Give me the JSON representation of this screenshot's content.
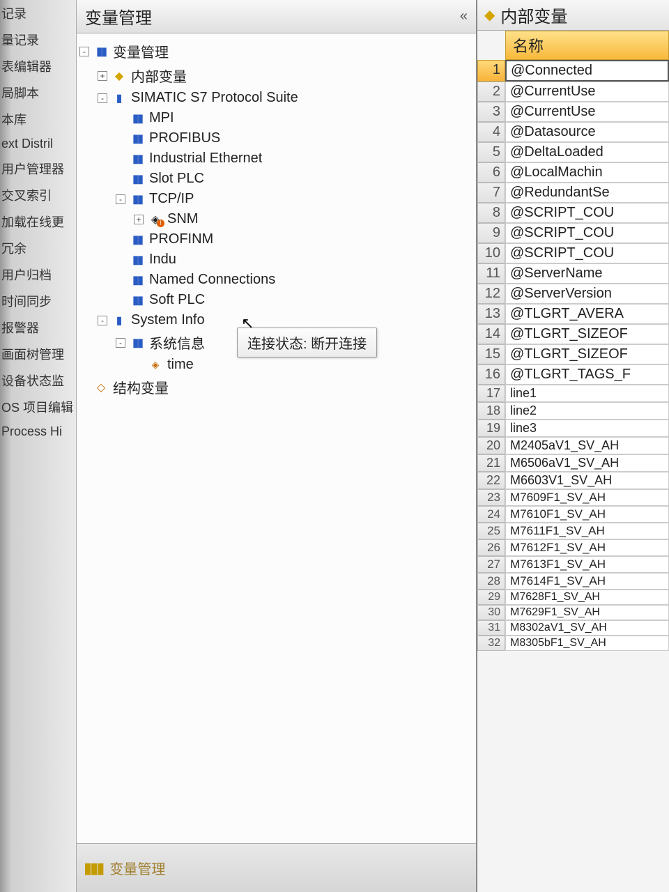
{
  "far_left": {
    "items": [
      "记录",
      "量记录",
      "表编辑器",
      "局脚本",
      "本库",
      "ext Distril",
      "用户管理器",
      "交叉索引",
      "加载在线更",
      "冗余",
      "用户归档",
      "时间同步",
      "报警器",
      "画面树管理",
      "设备状态监",
      "OS 项目编辑",
      "Process Hi"
    ]
  },
  "tree_panel": {
    "title": "变量管理",
    "collapse_glyph": "«",
    "footer_label": "变量管理",
    "tooltip": "连接状态: 断开连接",
    "nodes": [
      {
        "depth": 0,
        "exp": "-",
        "icon": "bars",
        "label": "变量管理"
      },
      {
        "depth": 1,
        "exp": "+",
        "icon": "cube",
        "label": "内部变量"
      },
      {
        "depth": 1,
        "exp": "-",
        "icon": "conn",
        "label": "SIMATIC S7 Protocol Suite"
      },
      {
        "depth": 2,
        "exp": " ",
        "icon": "bars",
        "label": "MPI"
      },
      {
        "depth": 2,
        "exp": " ",
        "icon": "bars",
        "label": "PROFIBUS"
      },
      {
        "depth": 2,
        "exp": " ",
        "icon": "bars",
        "label": "Industrial Ethernet"
      },
      {
        "depth": 2,
        "exp": " ",
        "icon": "bars",
        "label": "Slot PLC"
      },
      {
        "depth": 2,
        "exp": "-",
        "icon": "bars",
        "label": "TCP/IP"
      },
      {
        "depth": 3,
        "exp": "+",
        "icon": "err",
        "label": "SNM"
      },
      {
        "depth": 2,
        "exp": " ",
        "icon": "bars",
        "label": "PROFINM"
      },
      {
        "depth": 2,
        "exp": " ",
        "icon": "bars",
        "label": "Indu"
      },
      {
        "depth": 2,
        "exp": " ",
        "icon": "bars",
        "label": "Named Connections"
      },
      {
        "depth": 2,
        "exp": " ",
        "icon": "bars",
        "label": "Soft PLC"
      },
      {
        "depth": 1,
        "exp": "-",
        "icon": "conn",
        "label": "System Info"
      },
      {
        "depth": 2,
        "exp": "-",
        "icon": "bars",
        "label": "系统信息"
      },
      {
        "depth": 3,
        "exp": " ",
        "icon": "tag",
        "label": "time"
      },
      {
        "depth": 0,
        "exp": " ",
        "icon": "struct",
        "label": "结构变量"
      }
    ]
  },
  "table_panel": {
    "title": "内部变量",
    "column_header": "名称",
    "rows": [
      "@Connected",
      "@CurrentUse",
      "@CurrentUse",
      "@Datasource",
      "@DeltaLoaded",
      "@LocalMachin",
      "@RedundantSe",
      "@SCRIPT_COU",
      "@SCRIPT_COU",
      "@SCRIPT_COU",
      "@ServerName",
      "@ServerVersion",
      "@TLGRT_AVERA",
      "@TLGRT_SIZEOF",
      "@TLGRT_SIZEOF",
      "@TLGRT_TAGS_F",
      "line1",
      "line2",
      "line3",
      "M2405aV1_SV_AH",
      "M6506aV1_SV_AH",
      "M6603V1_SV_AH",
      "M7609F1_SV_AH",
      "M7610F1_SV_AH",
      "M7611F1_SV_AH",
      "M7612F1_SV_AH",
      "M7613F1_SV_AH",
      "M7614F1_SV_AH",
      "M7628F1_SV_AH",
      "M7629F1_SV_AH",
      "M8302aV1_SV_AH",
      "M8305bF1_SV_AH"
    ],
    "selected_index": 0
  }
}
